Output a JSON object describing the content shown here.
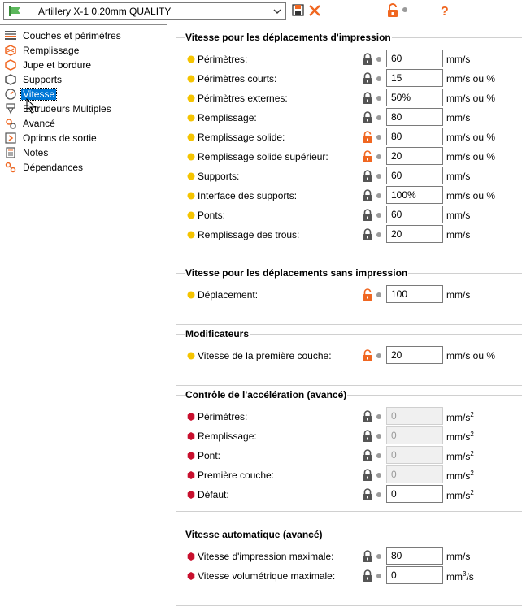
{
  "toolbar": {
    "preset_name": "Artillery X-1 0.20mm QUALITY",
    "icons": [
      "flag-icon",
      "chevron-down-icon",
      "save-icon",
      "delete-icon",
      "unlock-icon",
      "question-icon"
    ],
    "colors": {
      "accent": "#f06721",
      "flag": "#5cb85c",
      "selection": "#0078d7"
    }
  },
  "tree": {
    "items": [
      {
        "label": "Couches et périmètres",
        "icon": "layers-icon"
      },
      {
        "label": "Remplissage",
        "icon": "infill-icon"
      },
      {
        "label": "Jupe et bordure",
        "icon": "skirt-icon"
      },
      {
        "label": "Supports",
        "icon": "support-icon"
      },
      {
        "label": "Vitesse",
        "icon": "speed-icon",
        "selected": true
      },
      {
        "label": "Extrudeurs Multiples",
        "icon": "extruder-icon"
      },
      {
        "label": "Avancé",
        "icon": "advanced-icon"
      },
      {
        "label": "Options de sortie",
        "icon": "output-icon"
      },
      {
        "label": "Notes",
        "icon": "notes-icon"
      },
      {
        "label": "Dépendances",
        "icon": "dependencies-icon"
      }
    ]
  },
  "groups": [
    {
      "title": "Vitesse pour les déplacements d'impression",
      "rows": [
        {
          "label": "Périmètres:",
          "value": "60",
          "unit": "mm/s",
          "dot": "yellow",
          "lock": "locked"
        },
        {
          "label": "Périmètres courts:",
          "value": "15",
          "unit": "mm/s ou %",
          "dot": "yellow",
          "lock": "locked"
        },
        {
          "label": "Périmètres externes:",
          "value": "50%",
          "unit": "mm/s ou %",
          "dot": "yellow",
          "lock": "locked"
        },
        {
          "label": "Remplissage:",
          "value": "80",
          "unit": "mm/s",
          "dot": "yellow",
          "lock": "locked"
        },
        {
          "label": "Remplissage solide:",
          "value": "80",
          "unit": "mm/s ou %",
          "dot": "yellow",
          "lock": "unlocked"
        },
        {
          "label": "Remplissage solide supérieur:",
          "value": "20",
          "unit": "mm/s ou %",
          "dot": "yellow",
          "lock": "unlocked"
        },
        {
          "label": "Supports:",
          "value": "60",
          "unit": "mm/s",
          "dot": "yellow",
          "lock": "locked"
        },
        {
          "label": "Interface des supports:",
          "value": "100%",
          "unit": "mm/s ou %",
          "dot": "yellow",
          "lock": "locked"
        },
        {
          "label": "Ponts:",
          "value": "60",
          "unit": "mm/s",
          "dot": "yellow",
          "lock": "locked"
        },
        {
          "label": "Remplissage des trous:",
          "value": "20",
          "unit": "mm/s",
          "dot": "yellow",
          "lock": "locked"
        }
      ]
    },
    {
      "title": "Vitesse pour les déplacements sans impression",
      "rows": [
        {
          "label": "Déplacement:",
          "value": "100",
          "unit": "mm/s",
          "dot": "yellow",
          "lock": "unlocked"
        }
      ]
    },
    {
      "title": "Modificateurs",
      "rows": [
        {
          "label": "Vitesse de la première couche:",
          "value": "20",
          "unit": "mm/s ou %",
          "dot": "yellow",
          "lock": "unlocked"
        }
      ]
    },
    {
      "title": "Contrôle de l'accélération (avancé)",
      "rows": [
        {
          "label": "Périmètres:",
          "value": "0",
          "unit": "mm/s",
          "unit_sup": "2",
          "dot": "red",
          "lock": "locked",
          "disabled": true
        },
        {
          "label": "Remplissage:",
          "value": "0",
          "unit": "mm/s",
          "unit_sup": "2",
          "dot": "red",
          "lock": "locked",
          "disabled": true
        },
        {
          "label": "Pont:",
          "value": "0",
          "unit": "mm/s",
          "unit_sup": "2",
          "dot": "red",
          "lock": "locked",
          "disabled": true
        },
        {
          "label": "Première couche:",
          "value": "0",
          "unit": "mm/s",
          "unit_sup": "2",
          "dot": "red",
          "lock": "locked",
          "disabled": true
        },
        {
          "label": "Défaut:",
          "value": "0",
          "unit": "mm/s",
          "unit_sup": "2",
          "dot": "red",
          "lock": "locked"
        }
      ]
    },
    {
      "title": "Vitesse automatique (avancé)",
      "rows": [
        {
          "label": "Vitesse d'impression maximale:",
          "value": "80",
          "unit": "mm/s",
          "dot": "red",
          "lock": "locked"
        },
        {
          "label": "Vitesse volumétrique maximale:",
          "value": "0",
          "unit": "mm",
          "unit_sup": "3",
          "unit_after": "/s",
          "dot": "red",
          "lock": "locked"
        }
      ]
    }
  ]
}
